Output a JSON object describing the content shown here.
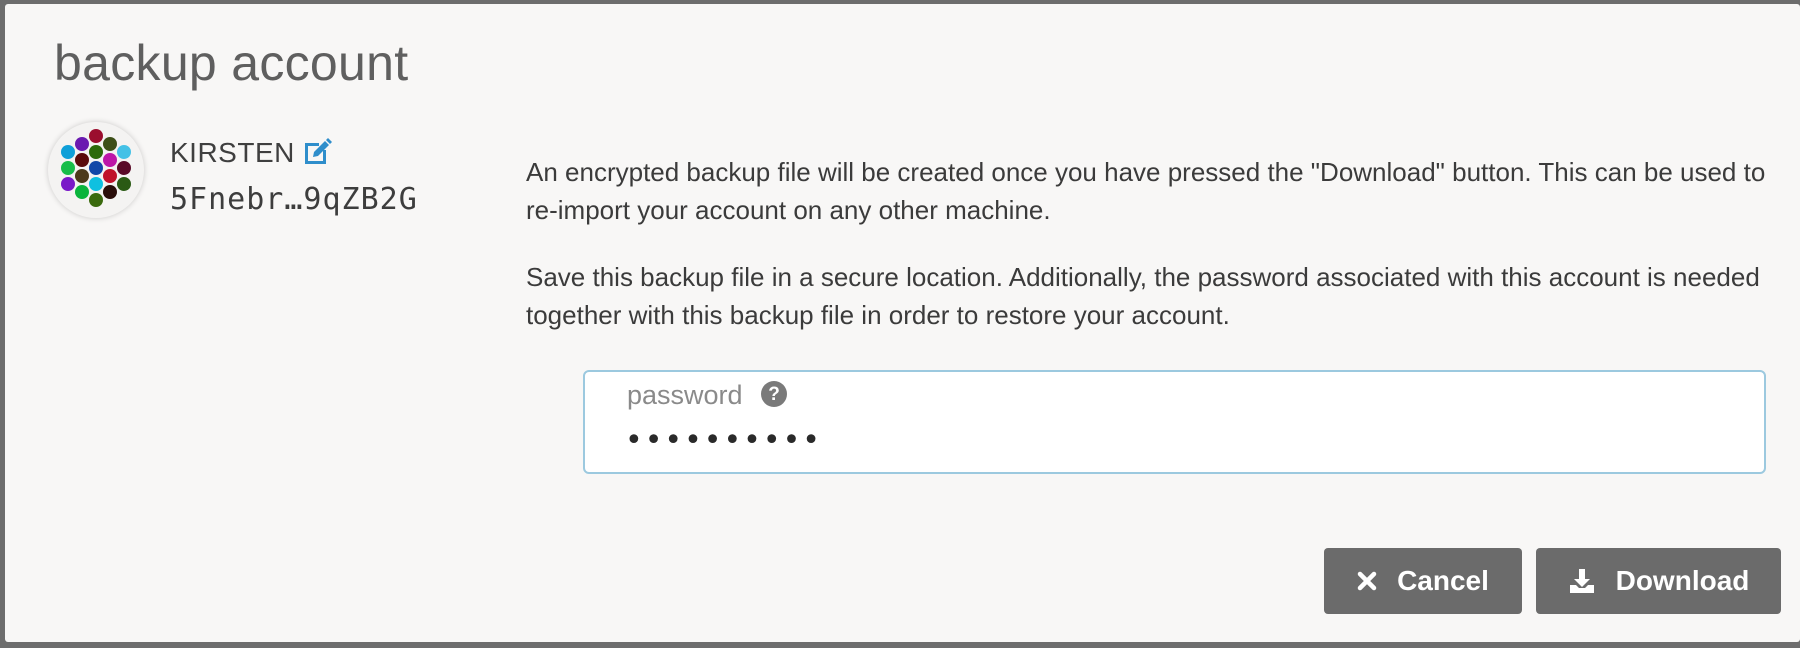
{
  "modal": {
    "title": "backup account"
  },
  "account": {
    "name": "KIRSTEN",
    "address": "5Fnebr…9qZB2G",
    "identicon_dot_colors": [
      "#9b0e2e",
      "#6a1ab0",
      "#3d4f18",
      "#0f9fd8",
      "#2b6a0a",
      "#44c1e6",
      "#5a0a0a",
      "#bd17a8",
      "#18bd49",
      "#1248a8",
      "#5a0a28",
      "#4d3a1a",
      "#c0122a",
      "#7a18c8",
      "#0fc0e0",
      "#2a5a14",
      "#0ab43c",
      "#2a0e0a",
      "#3a6a0e",
      "#0a9ad8"
    ]
  },
  "description": {
    "paragraph1": "An encrypted backup file will be created once you have pressed the \"Download\" button. This can be used to re-import your account on any other machine.",
    "paragraph2": "Save this backup file in a secure location. Additionally, the password associated with this account is needed together with this backup file in order to restore your account."
  },
  "password_field": {
    "label": "password",
    "value": "••••••••••"
  },
  "buttons": {
    "cancel_label": "Cancel",
    "download_label": "Download"
  },
  "colors": {
    "accent": "#2f8ecb",
    "button_bg": "#6b6b6b",
    "input_border": "#9cc9df"
  }
}
